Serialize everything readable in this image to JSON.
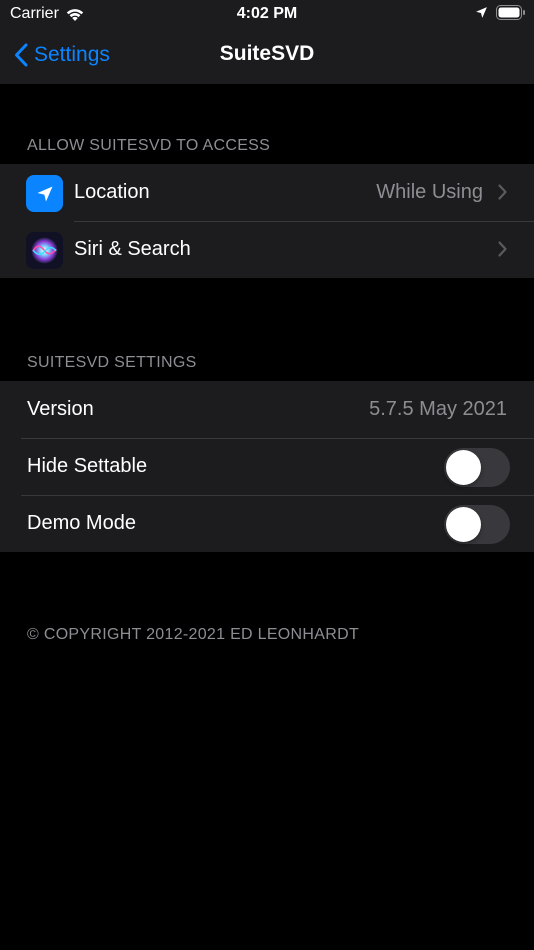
{
  "status_bar": {
    "carrier": "Carrier",
    "time": "4:02 PM",
    "icons": [
      "wifi-icon",
      "location-arrow-icon",
      "battery-icon"
    ]
  },
  "nav": {
    "back_label": "Settings",
    "title": "SuiteSVD"
  },
  "access_section": {
    "header": "ALLOW SUITESVD TO ACCESS",
    "rows": [
      {
        "icon": "location-arrow-icon",
        "label": "Location",
        "value": "While Using"
      },
      {
        "icon": "siri-icon",
        "label": "Siri & Search"
      }
    ]
  },
  "settings_section": {
    "header": "SUITESVD SETTINGS",
    "version_label": "Version",
    "version_value": "5.7.5 May 2021",
    "hide_settable_label": "Hide Settable",
    "hide_settable_on": false,
    "demo_mode_label": "Demo Mode",
    "demo_mode_on": false
  },
  "footer": "© COPYRIGHT 2012-2021 ED LEONHARDT",
  "colors": {
    "accent": "#0a84ff",
    "background": "#000000",
    "grouped_row": "#1c1c1e",
    "secondary_text": "#8d8d93"
  }
}
